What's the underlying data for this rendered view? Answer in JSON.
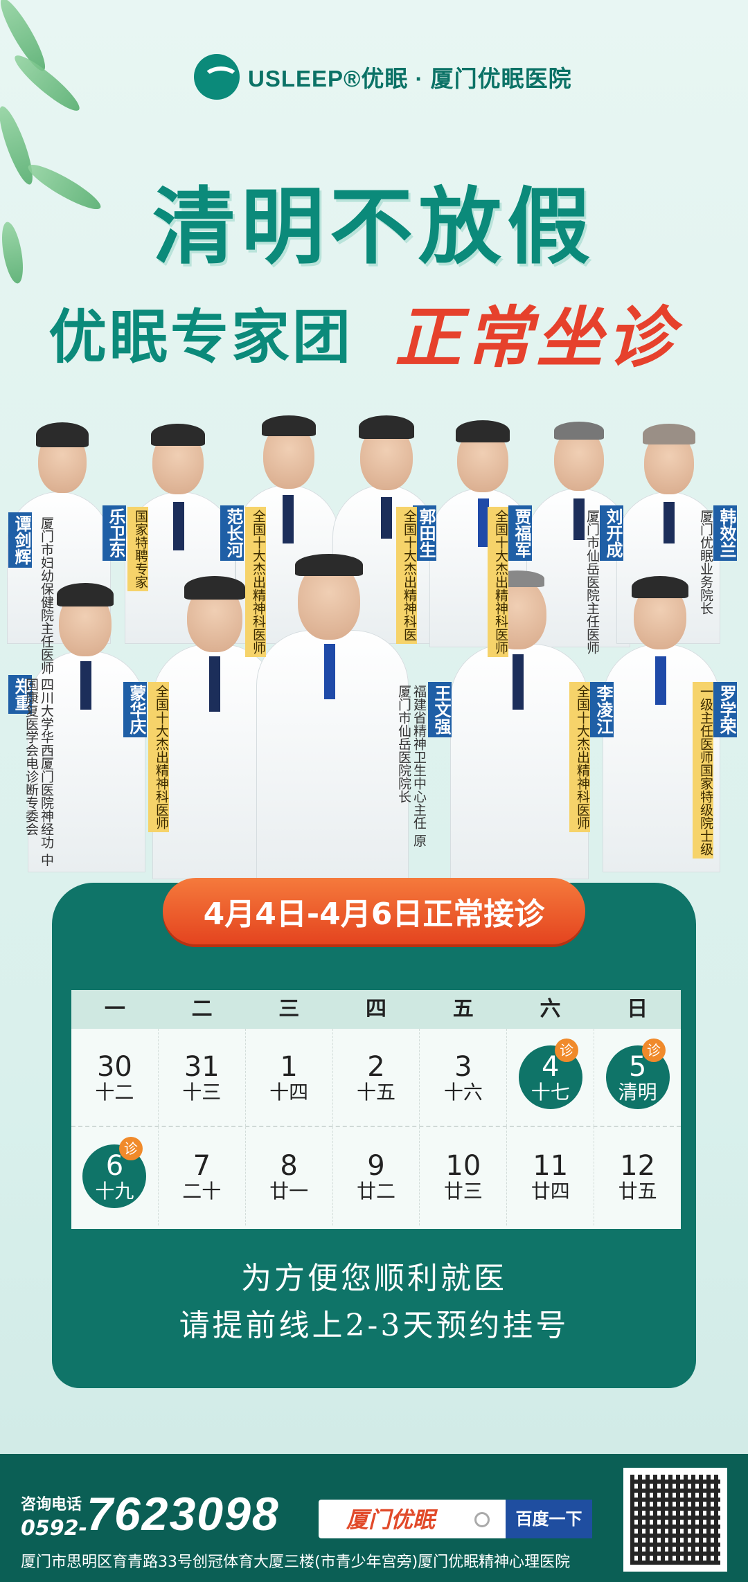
{
  "header": {
    "logo_text": "USLEEP®优眠 · 厦门优眠医院",
    "title_line1": "清明不放假",
    "title_line2_part1": "优眠专家团",
    "title_line2_part2": "正常坐诊"
  },
  "doctors": [
    {
      "name": "谭剑辉",
      "title": "厦门市妇幼保健院主任医师",
      "gold": false
    },
    {
      "name": "乐卫东",
      "title": "国家特聘专家",
      "gold": true
    },
    {
      "name": "范长河",
      "title": "全国十大杰出精神科医师",
      "gold": true
    },
    {
      "name": "郭田生",
      "title": "全国十大杰出精神科医",
      "gold": true
    },
    {
      "name": "贾福军",
      "title": "全国十大杰出精神科医师",
      "gold": true
    },
    {
      "name": "刘开成",
      "title": "厦门市仙岳医院主任医师",
      "gold": false
    },
    {
      "name": "韩效兰",
      "title": "厦门优眠业务院长",
      "gold": false
    },
    {
      "name": "郑重",
      "title": "四川大学华西厦门医院神经功 中国康复医学会电诊断专委会",
      "gold": false
    },
    {
      "name": "蒙华庆",
      "title": "全国十大杰出精神科医师",
      "gold": true
    },
    {
      "name": "王文强",
      "title": "福建省精神卫生中心主任 原厦门市仙岳医院院长",
      "gold": false
    },
    {
      "name": "李凌江",
      "title": "全国十大杰出精神科医师",
      "gold": true
    },
    {
      "name": "罗学荣",
      "title": "一级主任医师国家特级院士级",
      "gold": true
    }
  ],
  "schedule": {
    "banner": "4月4日-4月6日正常接诊",
    "weekdays": [
      "一",
      "二",
      "三",
      "四",
      "五",
      "六",
      "日"
    ],
    "row1": [
      {
        "n": "30",
        "l": "十二",
        "hl": false
      },
      {
        "n": "31",
        "l": "十三",
        "hl": false
      },
      {
        "n": "1",
        "l": "十四",
        "hl": false
      },
      {
        "n": "2",
        "l": "十五",
        "hl": false
      },
      {
        "n": "3",
        "l": "十六",
        "hl": false
      },
      {
        "n": "4",
        "l": "十七",
        "hl": true
      },
      {
        "n": "5",
        "l": "清明",
        "hl": true
      }
    ],
    "row2": [
      {
        "n": "6",
        "l": "十九",
        "hl": true
      },
      {
        "n": "7",
        "l": "二十",
        "hl": false
      },
      {
        "n": "8",
        "l": "廿一",
        "hl": false
      },
      {
        "n": "9",
        "l": "廿二",
        "hl": false
      },
      {
        "n": "10",
        "l": "廿三",
        "hl": false
      },
      {
        "n": "11",
        "l": "廿四",
        "hl": false
      },
      {
        "n": "12",
        "l": "廿五",
        "hl": false
      }
    ],
    "badge": "诊",
    "note1": "为方便您顺利就医",
    "note2": "请提前线上2-3天预约挂号"
  },
  "footer": {
    "phone_label": "咨询电话",
    "area_code": "0592-",
    "phone_number": "7623098",
    "search_text": "厦门优眠",
    "search_button": "百度一下",
    "address": "厦门市思明区育青路33号创冠体育大厦三楼(市青少年宫旁)厦门优眠精神心理医院"
  },
  "colors": {
    "teal": "#0f7468",
    "orange": "#e4441f",
    "name_blue": "#1f5fa6"
  }
}
